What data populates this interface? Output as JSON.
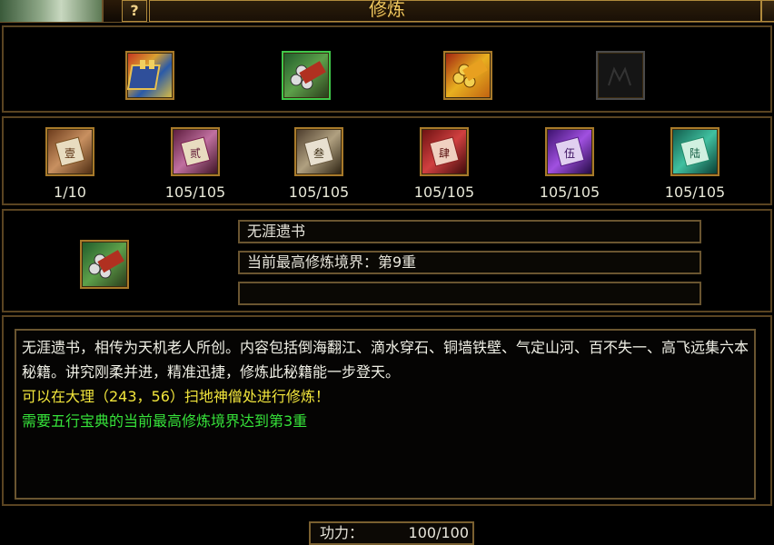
{
  "window": {
    "title": "修炼",
    "help_label": "?"
  },
  "top_items": [
    {
      "icon": "book-icon",
      "selected": false
    },
    {
      "icon": "scroll-bundle-icon",
      "selected": true
    },
    {
      "icon": "golden-scroll-bundle-icon",
      "selected": false
    },
    {
      "icon": "empty-slot-icon",
      "selected": false
    }
  ],
  "books": [
    {
      "icon": "scroll-icon",
      "progress": "1/10"
    },
    {
      "icon": "scroll-icon",
      "progress": "105/105"
    },
    {
      "icon": "scroll-icon",
      "progress": "105/105"
    },
    {
      "icon": "scroll-icon",
      "progress": "105/105"
    },
    {
      "icon": "scroll-icon",
      "progress": "105/105"
    },
    {
      "icon": "scroll-icon",
      "progress": "105/105"
    }
  ],
  "detail": {
    "icon": "scroll-bundle-icon",
    "name": "无涯遗书",
    "realm": "当前最高修炼境界：第9重",
    "extra": ""
  },
  "description": {
    "body": "无涯遗书，相传为天机老人所创。内容包括倒海翻江、滴水穿石、铜墙铁壁、气定山河、百不失一、高飞远集六本秘籍。讲究刚柔并进，精准迅捷，修炼此秘籍能一步登天。",
    "location": "可以在大理（243，56）扫地神僧处进行修炼！",
    "requirement": "需要五行宝典的当前最高修炼境界达到第3重"
  },
  "gongli": {
    "label": "功力：",
    "value": "100/100"
  },
  "colors": {
    "frame": "#5a4421",
    "gold": "#b08a3c",
    "highlight": "#3fc84a",
    "yellow_text": "#f2e63c",
    "green_text": "#36e33a"
  }
}
